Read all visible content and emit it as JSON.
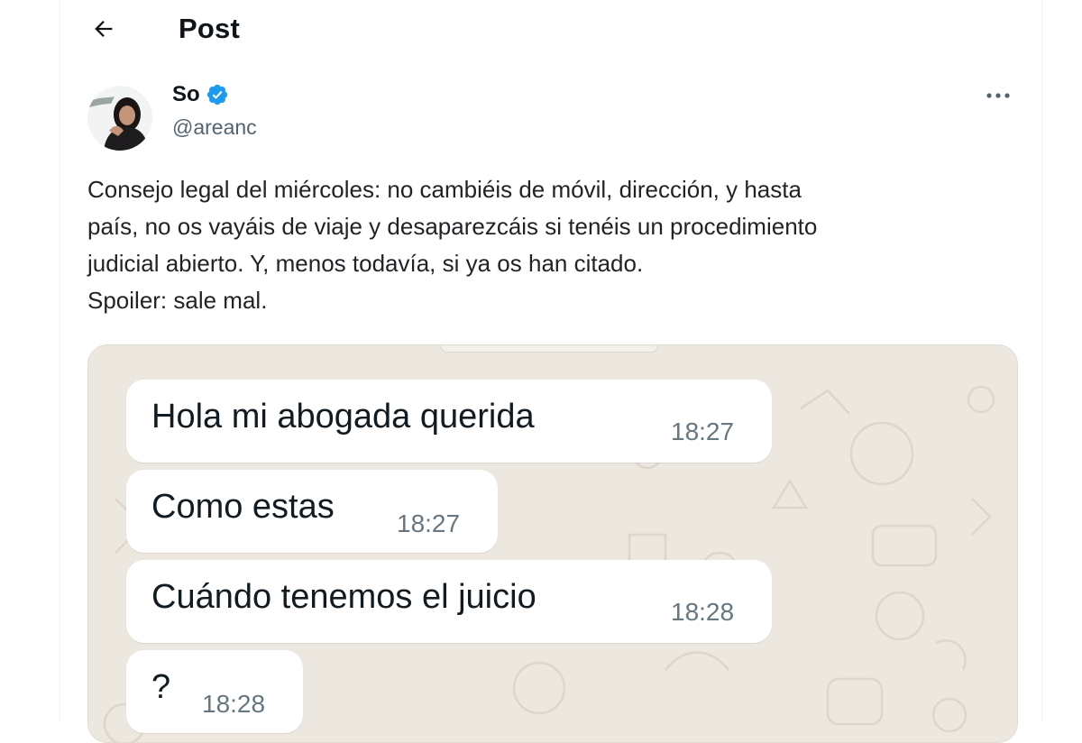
{
  "header": {
    "title": "Post"
  },
  "author": {
    "name": "So",
    "handle": "@areanc"
  },
  "tweet": {
    "lines": [
      "Consejo legal del miércoles: no cambiéis de móvil, dirección, y hasta",
      "país, no os vayáis de viaje y desaparezcáis si tenéis un procedimiento",
      "judicial abierto. Y, menos todavía, si ya os han citado.",
      "Spoiler: sale mal."
    ]
  },
  "chat": {
    "messages": [
      {
        "text": "Hola mi abogada querida",
        "time": "18:27"
      },
      {
        "text": "Como estas",
        "time": "18:27"
      },
      {
        "text": "Cuándo tenemos el juicio",
        "time": "18:28"
      },
      {
        "text": "?",
        "time": "18:28"
      }
    ]
  },
  "colors": {
    "verified_badge": "#1d9bf0",
    "secondary_text": "#536471",
    "chat_background": "#ece7df",
    "bubble": "#ffffff"
  },
  "icons": {
    "back": "arrow-left-icon",
    "verified": "verified-badge-icon",
    "more": "more-horizontal-icon"
  }
}
